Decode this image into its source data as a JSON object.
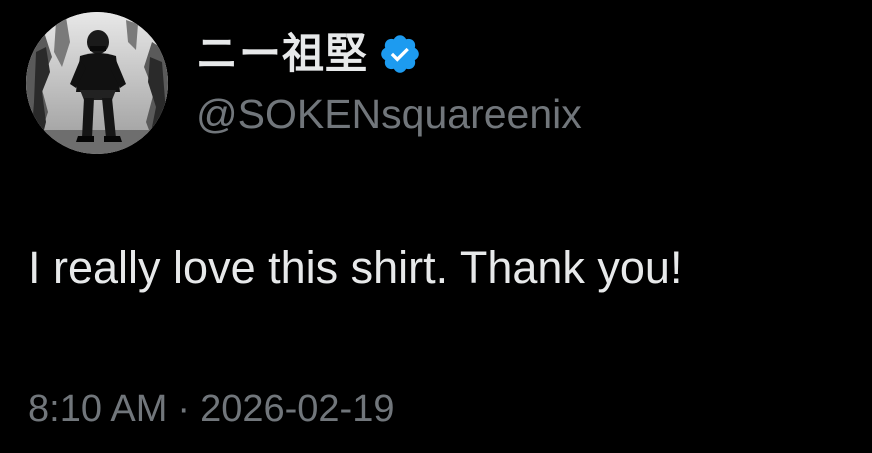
{
  "user": {
    "display_name": "ニー祖堅",
    "handle": "@SOKENsquareenix",
    "verified_icon": "verified-badge-icon",
    "verified_color": "#1d9bf0",
    "avatar_icon": "user-avatar"
  },
  "tweet": {
    "text": "I really love this shirt. Thank you!",
    "time": "8:10 AM",
    "separator": "·",
    "date": "2026-02-19"
  },
  "colors": {
    "background": "#000000",
    "primary_text": "#e7e9ea",
    "secondary_text": "#71767b"
  }
}
